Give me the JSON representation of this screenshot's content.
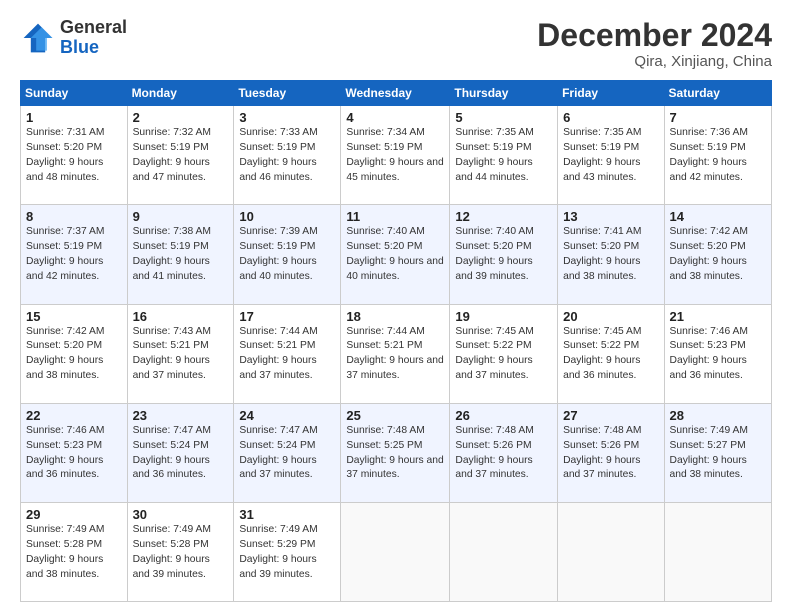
{
  "header": {
    "logo_general": "General",
    "logo_blue": "Blue",
    "month_title": "December 2024",
    "location": "Qira, Xinjiang, China"
  },
  "weekdays": [
    "Sunday",
    "Monday",
    "Tuesday",
    "Wednesday",
    "Thursday",
    "Friday",
    "Saturday"
  ],
  "weeks": [
    [
      {
        "day": "1",
        "sunrise": "Sunrise: 7:31 AM",
        "sunset": "Sunset: 5:20 PM",
        "daylight": "Daylight: 9 hours and 48 minutes."
      },
      {
        "day": "2",
        "sunrise": "Sunrise: 7:32 AM",
        "sunset": "Sunset: 5:19 PM",
        "daylight": "Daylight: 9 hours and 47 minutes."
      },
      {
        "day": "3",
        "sunrise": "Sunrise: 7:33 AM",
        "sunset": "Sunset: 5:19 PM",
        "daylight": "Daylight: 9 hours and 46 minutes."
      },
      {
        "day": "4",
        "sunrise": "Sunrise: 7:34 AM",
        "sunset": "Sunset: 5:19 PM",
        "daylight": "Daylight: 9 hours and 45 minutes."
      },
      {
        "day": "5",
        "sunrise": "Sunrise: 7:35 AM",
        "sunset": "Sunset: 5:19 PM",
        "daylight": "Daylight: 9 hours and 44 minutes."
      },
      {
        "day": "6",
        "sunrise": "Sunrise: 7:35 AM",
        "sunset": "Sunset: 5:19 PM",
        "daylight": "Daylight: 9 hours and 43 minutes."
      },
      {
        "day": "7",
        "sunrise": "Sunrise: 7:36 AM",
        "sunset": "Sunset: 5:19 PM",
        "daylight": "Daylight: 9 hours and 42 minutes."
      }
    ],
    [
      {
        "day": "8",
        "sunrise": "Sunrise: 7:37 AM",
        "sunset": "Sunset: 5:19 PM",
        "daylight": "Daylight: 9 hours and 42 minutes."
      },
      {
        "day": "9",
        "sunrise": "Sunrise: 7:38 AM",
        "sunset": "Sunset: 5:19 PM",
        "daylight": "Daylight: 9 hours and 41 minutes."
      },
      {
        "day": "10",
        "sunrise": "Sunrise: 7:39 AM",
        "sunset": "Sunset: 5:19 PM",
        "daylight": "Daylight: 9 hours and 40 minutes."
      },
      {
        "day": "11",
        "sunrise": "Sunrise: 7:40 AM",
        "sunset": "Sunset: 5:20 PM",
        "daylight": "Daylight: 9 hours and 40 minutes."
      },
      {
        "day": "12",
        "sunrise": "Sunrise: 7:40 AM",
        "sunset": "Sunset: 5:20 PM",
        "daylight": "Daylight: 9 hours and 39 minutes."
      },
      {
        "day": "13",
        "sunrise": "Sunrise: 7:41 AM",
        "sunset": "Sunset: 5:20 PM",
        "daylight": "Daylight: 9 hours and 38 minutes."
      },
      {
        "day": "14",
        "sunrise": "Sunrise: 7:42 AM",
        "sunset": "Sunset: 5:20 PM",
        "daylight": "Daylight: 9 hours and 38 minutes."
      }
    ],
    [
      {
        "day": "15",
        "sunrise": "Sunrise: 7:42 AM",
        "sunset": "Sunset: 5:20 PM",
        "daylight": "Daylight: 9 hours and 38 minutes."
      },
      {
        "day": "16",
        "sunrise": "Sunrise: 7:43 AM",
        "sunset": "Sunset: 5:21 PM",
        "daylight": "Daylight: 9 hours and 37 minutes."
      },
      {
        "day": "17",
        "sunrise": "Sunrise: 7:44 AM",
        "sunset": "Sunset: 5:21 PM",
        "daylight": "Daylight: 9 hours and 37 minutes."
      },
      {
        "day": "18",
        "sunrise": "Sunrise: 7:44 AM",
        "sunset": "Sunset: 5:21 PM",
        "daylight": "Daylight: 9 hours and 37 minutes."
      },
      {
        "day": "19",
        "sunrise": "Sunrise: 7:45 AM",
        "sunset": "Sunset: 5:22 PM",
        "daylight": "Daylight: 9 hours and 37 minutes."
      },
      {
        "day": "20",
        "sunrise": "Sunrise: 7:45 AM",
        "sunset": "Sunset: 5:22 PM",
        "daylight": "Daylight: 9 hours and 36 minutes."
      },
      {
        "day": "21",
        "sunrise": "Sunrise: 7:46 AM",
        "sunset": "Sunset: 5:23 PM",
        "daylight": "Daylight: 9 hours and 36 minutes."
      }
    ],
    [
      {
        "day": "22",
        "sunrise": "Sunrise: 7:46 AM",
        "sunset": "Sunset: 5:23 PM",
        "daylight": "Daylight: 9 hours and 36 minutes."
      },
      {
        "day": "23",
        "sunrise": "Sunrise: 7:47 AM",
        "sunset": "Sunset: 5:24 PM",
        "daylight": "Daylight: 9 hours and 36 minutes."
      },
      {
        "day": "24",
        "sunrise": "Sunrise: 7:47 AM",
        "sunset": "Sunset: 5:24 PM",
        "daylight": "Daylight: 9 hours and 37 minutes."
      },
      {
        "day": "25",
        "sunrise": "Sunrise: 7:48 AM",
        "sunset": "Sunset: 5:25 PM",
        "daylight": "Daylight: 9 hours and 37 minutes."
      },
      {
        "day": "26",
        "sunrise": "Sunrise: 7:48 AM",
        "sunset": "Sunset: 5:26 PM",
        "daylight": "Daylight: 9 hours and 37 minutes."
      },
      {
        "day": "27",
        "sunrise": "Sunrise: 7:48 AM",
        "sunset": "Sunset: 5:26 PM",
        "daylight": "Daylight: 9 hours and 37 minutes."
      },
      {
        "day": "28",
        "sunrise": "Sunrise: 7:49 AM",
        "sunset": "Sunset: 5:27 PM",
        "daylight": "Daylight: 9 hours and 38 minutes."
      }
    ],
    [
      {
        "day": "29",
        "sunrise": "Sunrise: 7:49 AM",
        "sunset": "Sunset: 5:28 PM",
        "daylight": "Daylight: 9 hours and 38 minutes."
      },
      {
        "day": "30",
        "sunrise": "Sunrise: 7:49 AM",
        "sunset": "Sunset: 5:28 PM",
        "daylight": "Daylight: 9 hours and 39 minutes."
      },
      {
        "day": "31",
        "sunrise": "Sunrise: 7:49 AM",
        "sunset": "Sunset: 5:29 PM",
        "daylight": "Daylight: 9 hours and 39 minutes."
      },
      null,
      null,
      null,
      null
    ]
  ]
}
